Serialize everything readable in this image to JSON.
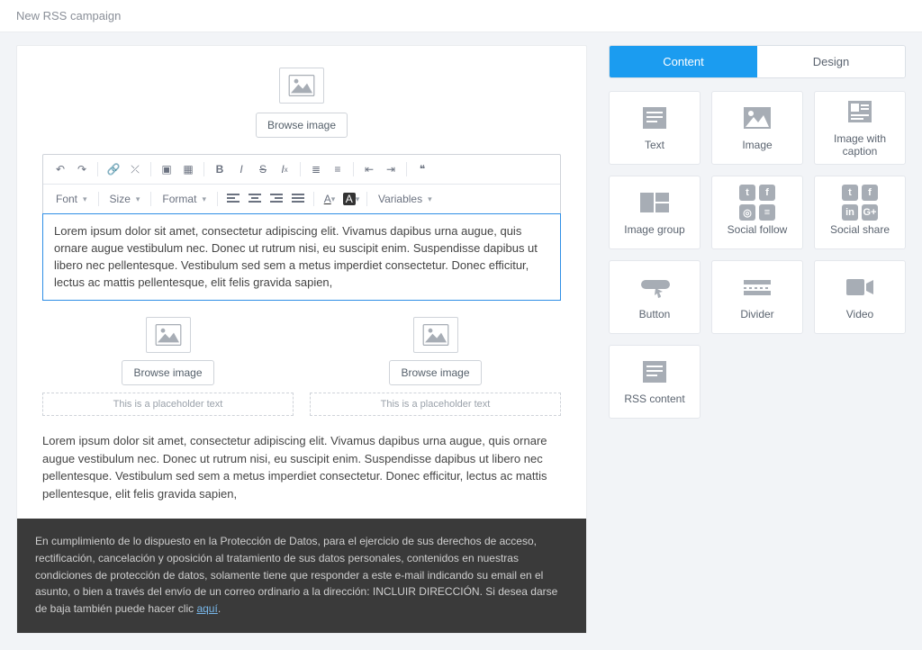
{
  "header": {
    "title": "New RSS campaign"
  },
  "canvas": {
    "browse_label": "Browse image",
    "placeholder_text": "This is a placeholder text",
    "body_text": "Lorem ipsum dolor sit amet, consectetur adipiscing elit. Vivamus dapibus urna augue, quis ornare augue vestibulum nec. Donec ut rutrum nisi, eu suscipit enim. Suspendisse dapibus ut libero nec pellentesque. Vestibulum sed sem a metus imperdiet consectetur. Donec efficitur, lectus ac mattis pellentesque, elit felis gravida sapien,",
    "footer_text": "En cumplimiento de lo dispuesto en la Protección de Datos, para el ejercicio de sus derechos de acceso, rectificación, cancelación y oposición al tratamiento de sus datos personales, contenidos en nuestras condiciones de protección de datos, solamente tiene que responder a este e-mail indicando su email en el asunto, o bien a través del envío de un correo ordinario a la dirección: INCLUIR DIRECCIÓN. Si desea darse de baja también puede hacer clic ",
    "footer_link": "aquí",
    "footer_after": "."
  },
  "toolbar": {
    "font": "Font",
    "size": "Size",
    "format": "Format",
    "variables": "Variables"
  },
  "sidebar": {
    "tabs": {
      "content": "Content",
      "design": "Design"
    },
    "tiles": {
      "text": "Text",
      "image": "Image",
      "image_caption": "Image with caption",
      "image_group": "Image group",
      "social_follow": "Social follow",
      "social_share": "Social share",
      "button": "Button",
      "divider": "Divider",
      "video": "Video",
      "rss": "RSS content"
    }
  }
}
